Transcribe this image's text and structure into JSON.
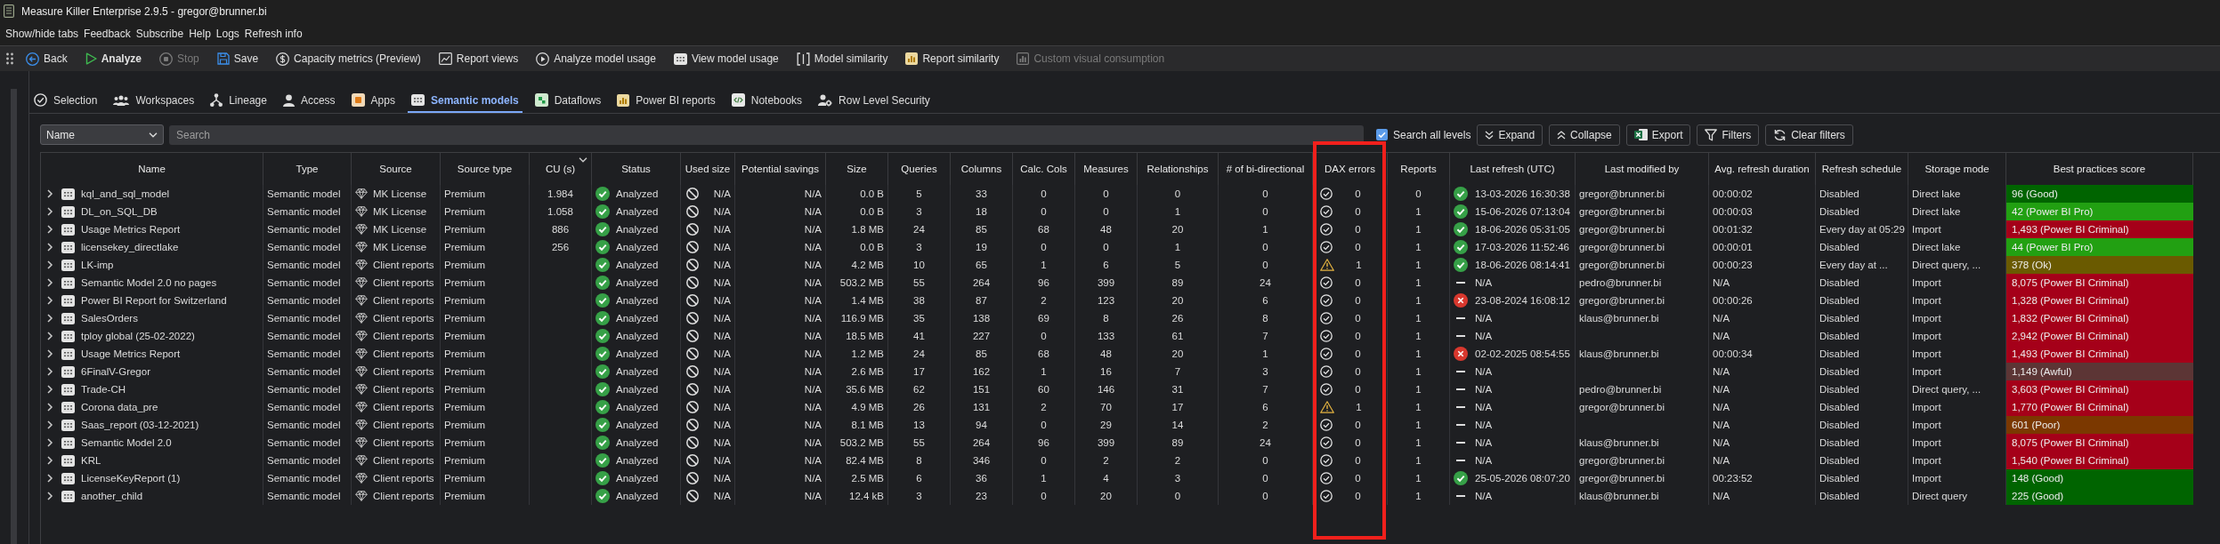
{
  "window": {
    "title": "Measure Killer Enterprise 2.9.5 - gregor@brunner.bi"
  },
  "menu": [
    "Show/hide tabs",
    "Feedback",
    "Subscribe",
    "Help",
    "Logs",
    "Refresh info"
  ],
  "toolbar": [
    {
      "label": "Back",
      "primary": false,
      "disabled": false
    },
    {
      "label": "Analyze",
      "primary": true,
      "disabled": false
    },
    {
      "label": "Stop",
      "primary": false,
      "disabled": true
    },
    {
      "label": "Save",
      "primary": false,
      "disabled": false
    },
    {
      "label": "Capacity metrics (Preview)",
      "primary": false,
      "disabled": false
    },
    {
      "label": "Report views",
      "primary": false,
      "disabled": false
    },
    {
      "label": "Analyze model usage",
      "primary": false,
      "disabled": false
    },
    {
      "label": "View model usage",
      "primary": false,
      "disabled": false
    },
    {
      "label": "Model similarity",
      "primary": false,
      "disabled": false
    },
    {
      "label": "Report similarity",
      "primary": false,
      "disabled": false
    },
    {
      "label": "Custom visual consumption",
      "primary": false,
      "disabled": true
    }
  ],
  "tabs": [
    {
      "label": "Selection",
      "selected": false
    },
    {
      "label": "Workspaces",
      "selected": false
    },
    {
      "label": "Lineage",
      "selected": false
    },
    {
      "label": "Access",
      "selected": false
    },
    {
      "label": "Apps",
      "selected": false
    },
    {
      "label": "Semantic models",
      "selected": true
    },
    {
      "label": "Dataflows",
      "selected": false
    },
    {
      "label": "Power BI reports",
      "selected": false
    },
    {
      "label": "Notebooks",
      "selected": false
    },
    {
      "label": "Row Level Security",
      "selected": false
    }
  ],
  "filter_bar": {
    "field_dropdown": "Name",
    "search": {
      "placeholder": "Search"
    },
    "search_all_levels": {
      "label": "Search all levels",
      "checked": true
    },
    "buttons": [
      "Expand",
      "Collapse",
      "Export",
      "Filters",
      "Clear filters"
    ]
  },
  "table": {
    "columns": [
      {
        "label": "Name",
        "sorted": false,
        "highlighted": false
      },
      {
        "label": "Type",
        "sorted": false,
        "highlighted": false
      },
      {
        "label": "Source",
        "sorted": false,
        "highlighted": false
      },
      {
        "label": "Source type",
        "sorted": false,
        "highlighted": false
      },
      {
        "label": "CU (s)",
        "sorted": true,
        "highlighted": false
      },
      {
        "label": "Status",
        "sorted": false,
        "highlighted": false
      },
      {
        "label": "Used size",
        "sorted": false,
        "highlighted": false
      },
      {
        "label": "Potential savings",
        "sorted": false,
        "highlighted": false
      },
      {
        "label": "Size",
        "sorted": false,
        "highlighted": false
      },
      {
        "label": "Queries",
        "sorted": false,
        "highlighted": false
      },
      {
        "label": "Columns",
        "sorted": false,
        "highlighted": false
      },
      {
        "label": "Calc. Cols",
        "sorted": false,
        "highlighted": false
      },
      {
        "label": "Measures",
        "sorted": false,
        "highlighted": false
      },
      {
        "label": "Relationships",
        "sorted": false,
        "highlighted": false
      },
      {
        "label": "# of bi-directional",
        "sorted": false,
        "highlighted": false
      },
      {
        "label": "DAX errors",
        "sorted": false,
        "highlighted": true
      },
      {
        "label": "Reports",
        "sorted": false,
        "highlighted": false
      },
      {
        "label": "Last refresh (UTC)",
        "sorted": false,
        "highlighted": false
      },
      {
        "label": "Last modified by",
        "sorted": false,
        "highlighted": false
      },
      {
        "label": "Avg. refresh duration",
        "sorted": false,
        "highlighted": false
      },
      {
        "label": "Refresh schedule",
        "sorted": false,
        "highlighted": false
      },
      {
        "label": "Storage mode",
        "sorted": false,
        "highlighted": false
      },
      {
        "label": "Best practices score",
        "sorted": false,
        "highlighted": false
      }
    ],
    "rows": [
      {
        "expanded": false,
        "name": "kql_and_sql_model",
        "type": "Semantic model",
        "source": "MK License",
        "source_type": "Premium",
        "cu": "1.984",
        "status": "Analyzed",
        "used_size": "N/A",
        "potential_savings": "N/A",
        "size": "0.0 B",
        "queries": "5",
        "columns": "33",
        "calc_cols": "0",
        "measures": "0",
        "relationships": "0",
        "bidirectional": "0",
        "dax_warning": false,
        "dax_errors": "0",
        "reports": "0",
        "last_refresh": {
          "kind": "success",
          "time": "13-03-2026 16:30:38"
        },
        "modified_by": "gregor@brunner.bi",
        "avg_refresh": "00:00:02",
        "schedule": "Disabled",
        "storage": "Direct lake",
        "score": "96 (Good)",
        "color": "#006400"
      },
      {
        "expanded": false,
        "name": "DL_on_SQL_DB",
        "type": "Semantic model",
        "source": "MK License",
        "source_type": "Premium",
        "cu": "1.058",
        "status": "Analyzed",
        "used_size": "N/A",
        "potential_savings": "N/A",
        "size": "0.0 B",
        "queries": "3",
        "columns": "18",
        "calc_cols": "0",
        "measures": "0",
        "relationships": "1",
        "bidirectional": "0",
        "dax_warning": false,
        "dax_errors": "0",
        "reports": "1",
        "last_refresh": {
          "kind": "success",
          "time": "15-06-2026 07:13:04"
        },
        "modified_by": "gregor@brunner.bi",
        "avg_refresh": "00:00:03",
        "schedule": "Disabled",
        "storage": "Direct lake",
        "score": "42 (Power BI Pro)",
        "color": "#22a012"
      },
      {
        "expanded": false,
        "name": "Usage Metrics Report",
        "type": "Semantic model",
        "source": "MK License",
        "source_type": "Premium",
        "cu": "886",
        "status": "Analyzed",
        "used_size": "N/A",
        "potential_savings": "N/A",
        "size": "1.8 MB",
        "queries": "24",
        "columns": "85",
        "calc_cols": "68",
        "measures": "48",
        "relationships": "20",
        "bidirectional": "1",
        "dax_warning": false,
        "dax_errors": "0",
        "reports": "1",
        "last_refresh": {
          "kind": "success",
          "time": "18-06-2026 05:31:05"
        },
        "modified_by": "gregor@brunner.bi",
        "avg_refresh": "00:01:32",
        "schedule": "Every day at 05:29",
        "storage": "Import",
        "score": "1,493 (Power BI Criminal)",
        "color": "#a50019"
      },
      {
        "expanded": false,
        "name": "licensekey_directlake",
        "type": "Semantic model",
        "source": "MK License",
        "source_type": "Premium",
        "cu": "256",
        "status": "Analyzed",
        "used_size": "N/A",
        "potential_savings": "N/A",
        "size": "0.0 B",
        "queries": "3",
        "columns": "19",
        "calc_cols": "0",
        "measures": "0",
        "relationships": "1",
        "bidirectional": "0",
        "dax_warning": false,
        "dax_errors": "0",
        "reports": "1",
        "last_refresh": {
          "kind": "success",
          "time": "17-03-2026 11:52:46"
        },
        "modified_by": "gregor@brunner.bi",
        "avg_refresh": "00:00:01",
        "schedule": "Disabled",
        "storage": "Direct lake",
        "score": "44 (Power BI Pro)",
        "color": "#22a012"
      },
      {
        "expanded": false,
        "name": "LK-imp",
        "type": "Semantic model",
        "source": "Client reports",
        "source_type": "Premium",
        "status": "Analyzed",
        "used_size": "N/A",
        "potential_savings": "N/A",
        "size": "4.2 MB",
        "queries": "10",
        "columns": "65",
        "calc_cols": "1",
        "measures": "6",
        "relationships": "5",
        "bidirectional": "0",
        "dax_warning": true,
        "dax_errors": "1",
        "reports": "1",
        "last_refresh": {
          "kind": "success",
          "time": "18-06-2026 08:14:41"
        },
        "modified_by": "gregor@brunner.bi",
        "avg_refresh": "00:00:23",
        "schedule": "Every day at ...",
        "storage": "Direct query, ...",
        "score": "378 (Ok)",
        "color": "#6a5a00"
      },
      {
        "expanded": false,
        "name": "Semantic Model 2.0 no pages",
        "type": "Semantic model",
        "source": "Client reports",
        "source_type": "Premium",
        "status": "Analyzed",
        "used_size": "N/A",
        "potential_savings": "N/A",
        "size": "503.2 MB",
        "queries": "55",
        "columns": "264",
        "calc_cols": "96",
        "measures": "399",
        "relationships": "89",
        "bidirectional": "24",
        "dax_warning": false,
        "dax_errors": "0",
        "reports": "1",
        "last_refresh": {
          "kind": "none",
          "time": "N/A"
        },
        "modified_by": "pedro@brunner.bi",
        "avg_refresh": "N/A",
        "schedule": "Disabled",
        "storage": "Import",
        "score": "8,075 (Power BI Criminal)",
        "color": "#a50019"
      },
      {
        "expanded": false,
        "name": "Power BI Report for Switzerland",
        "type": "Semantic model",
        "source": "Client reports",
        "source_type": "Premium",
        "status": "Analyzed",
        "used_size": "N/A",
        "potential_savings": "N/A",
        "size": "1.4 MB",
        "queries": "38",
        "columns": "87",
        "calc_cols": "2",
        "measures": "123",
        "relationships": "20",
        "bidirectional": "6",
        "dax_warning": false,
        "dax_errors": "0",
        "reports": "1",
        "last_refresh": {
          "kind": "failed",
          "time": "23-08-2024 16:08:12"
        },
        "modified_by": "gregor@brunner.bi",
        "avg_refresh": "00:00:26",
        "schedule": "Disabled",
        "storage": "Import",
        "score": "1,328 (Power BI Criminal)",
        "color": "#a50019"
      },
      {
        "expanded": false,
        "name": "SalesOrders",
        "type": "Semantic model",
        "source": "Client reports",
        "source_type": "Premium",
        "status": "Analyzed",
        "used_size": "N/A",
        "potential_savings": "N/A",
        "size": "116.9 MB",
        "queries": "35",
        "columns": "138",
        "calc_cols": "69",
        "measures": "8",
        "relationships": "26",
        "bidirectional": "8",
        "dax_warning": false,
        "dax_errors": "0",
        "reports": "1",
        "last_refresh": {
          "kind": "none",
          "time": "N/A"
        },
        "modified_by": "klaus@brunner.bi",
        "avg_refresh": "N/A",
        "schedule": "Disabled",
        "storage": "Import",
        "score": "1,832 (Power BI Criminal)",
        "color": "#a50019"
      },
      {
        "expanded": false,
        "name": "tploy global (25-02-2022)",
        "type": "Semantic model",
        "source": "Client reports",
        "source_type": "Premium",
        "status": "Analyzed",
        "used_size": "N/A",
        "potential_savings": "N/A",
        "size": "18.5 MB",
        "queries": "41",
        "columns": "227",
        "calc_cols": "0",
        "measures": "133",
        "relationships": "61",
        "bidirectional": "7",
        "dax_warning": false,
        "dax_errors": "0",
        "reports": "1",
        "last_refresh": {
          "kind": "none",
          "time": "N/A"
        },
        "avg_refresh": "N/A",
        "schedule": "Disabled",
        "storage": "Import",
        "score": "2,942 (Power BI Criminal)",
        "color": "#a50019"
      },
      {
        "expanded": false,
        "name": "Usage Metrics Report",
        "type": "Semantic model",
        "source": "Client reports",
        "source_type": "Premium",
        "status": "Analyzed",
        "used_size": "N/A",
        "potential_savings": "N/A",
        "size": "1.2 MB",
        "queries": "24",
        "columns": "85",
        "calc_cols": "68",
        "measures": "48",
        "relationships": "20",
        "bidirectional": "1",
        "dax_warning": false,
        "dax_errors": "0",
        "reports": "1",
        "last_refresh": {
          "kind": "failed",
          "time": "02-02-2025 08:54:55"
        },
        "modified_by": "klaus@brunner.bi",
        "avg_refresh": "00:00:34",
        "schedule": "Disabled",
        "storage": "Import",
        "score": "1,493 (Power BI Criminal)",
        "color": "#a50019"
      },
      {
        "expanded": false,
        "name": "6FinalV-Gregor",
        "type": "Semantic model",
        "source": "Client reports",
        "source_type": "Premium",
        "status": "Analyzed",
        "used_size": "N/A",
        "potential_savings": "N/A",
        "size": "2.6 MB",
        "queries": "17",
        "columns": "162",
        "calc_cols": "1",
        "measures": "16",
        "relationships": "7",
        "bidirectional": "3",
        "dax_warning": false,
        "dax_errors": "0",
        "reports": "1",
        "last_refresh": {
          "kind": "none",
          "time": "N/A"
        },
        "avg_refresh": "N/A",
        "schedule": "Disabled",
        "storage": "Import",
        "score": "1,149 (Awful)",
        "color": "#5c3535"
      },
      {
        "expanded": false,
        "name": "Trade-CH",
        "type": "Semantic model",
        "source": "Client reports",
        "source_type": "Premium",
        "status": "Analyzed",
        "used_size": "N/A",
        "potential_savings": "N/A",
        "size": "35.6 MB",
        "queries": "62",
        "columns": "151",
        "calc_cols": "60",
        "measures": "146",
        "relationships": "31",
        "bidirectional": "7",
        "dax_warning": false,
        "dax_errors": "0",
        "reports": "1",
        "last_refresh": {
          "kind": "none",
          "time": "N/A"
        },
        "modified_by": "pedro@brunner.bi",
        "avg_refresh": "N/A",
        "schedule": "Disabled",
        "storage": "Direct query, ...",
        "score": "3,603 (Power BI Criminal)",
        "color": "#a50019"
      },
      {
        "expanded": false,
        "name": "Corona data_pre",
        "type": "Semantic model",
        "source": "Client reports",
        "source_type": "Premium",
        "status": "Analyzed",
        "used_size": "N/A",
        "potential_savings": "N/A",
        "size": "4.9 MB",
        "queries": "26",
        "columns": "131",
        "calc_cols": "2",
        "measures": "70",
        "relationships": "17",
        "bidirectional": "6",
        "dax_warning": true,
        "dax_errors": "1",
        "reports": "1",
        "last_refresh": {
          "kind": "none",
          "time": "N/A"
        },
        "modified_by": "gregor@brunner.bi",
        "avg_refresh": "N/A",
        "schedule": "Disabled",
        "storage": "Import",
        "score": "1,770 (Power BI Criminal)",
        "color": "#a50019"
      },
      {
        "expanded": false,
        "name": "Saas_report (03-12-2021)",
        "type": "Semantic model",
        "source": "Client reports",
        "source_type": "Premium",
        "status": "Analyzed",
        "used_size": "N/A",
        "potential_savings": "N/A",
        "size": "8.1 MB",
        "queries": "13",
        "columns": "94",
        "calc_cols": "0",
        "measures": "29",
        "relationships": "14",
        "bidirectional": "2",
        "dax_warning": false,
        "dax_errors": "0",
        "reports": "1",
        "last_refresh": {
          "kind": "none",
          "time": "N/A"
        },
        "avg_refresh": "N/A",
        "schedule": "Disabled",
        "storage": "Import",
        "score": "601 (Poor)",
        "color": "#7b3800"
      },
      {
        "expanded": false,
        "name": "Semantic Model 2.0",
        "type": "Semantic model",
        "source": "Client reports",
        "source_type": "Premium",
        "status": "Analyzed",
        "used_size": "N/A",
        "potential_savings": "N/A",
        "size": "503.2 MB",
        "queries": "55",
        "columns": "264",
        "calc_cols": "96",
        "measures": "399",
        "relationships": "89",
        "bidirectional": "24",
        "dax_warning": false,
        "dax_errors": "0",
        "reports": "1",
        "last_refresh": {
          "kind": "none",
          "time": "N/A"
        },
        "modified_by": "klaus@brunner.bi",
        "avg_refresh": "N/A",
        "schedule": "Disabled",
        "storage": "Import",
        "score": "8,075 (Power BI Criminal)",
        "color": "#a50019"
      },
      {
        "expanded": false,
        "name": "KRL",
        "type": "Semantic model",
        "source": "Client reports",
        "source_type": "Premium",
        "status": "Analyzed",
        "used_size": "N/A",
        "potential_savings": "N/A",
        "size": "82.4 MB",
        "queries": "8",
        "columns": "346",
        "calc_cols": "0",
        "measures": "2",
        "relationships": "2",
        "bidirectional": "0",
        "dax_warning": false,
        "dax_errors": "0",
        "reports": "1",
        "last_refresh": {
          "kind": "none",
          "time": "N/A"
        },
        "modified_by": "gregor@brunner.bi",
        "avg_refresh": "N/A",
        "schedule": "Disabled",
        "storage": "Import",
        "score": "1,540 (Power BI Criminal)",
        "color": "#a50019"
      },
      {
        "expanded": false,
        "name": "LicenseKeyReport (1)",
        "type": "Semantic model",
        "source": "Client reports",
        "source_type": "Premium",
        "status": "Analyzed",
        "used_size": "N/A",
        "potential_savings": "N/A",
        "size": "2.5 MB",
        "queries": "6",
        "columns": "36",
        "calc_cols": "1",
        "measures": "4",
        "relationships": "3",
        "bidirectional": "0",
        "dax_warning": false,
        "dax_errors": "0",
        "reports": "1",
        "last_refresh": {
          "kind": "success",
          "time": "25-05-2026 08:07:20"
        },
        "modified_by": "gregor@brunner.bi",
        "avg_refresh": "00:23:52",
        "schedule": "Disabled",
        "storage": "Import",
        "score": "148 (Good)",
        "color": "#006400"
      },
      {
        "expanded": false,
        "name": "another_child",
        "type": "Semantic model",
        "source": "Client reports",
        "source_type": "Premium",
        "status": "Analyzed",
        "used_size": "N/A",
        "potential_savings": "N/A",
        "size": "12.4 kB",
        "queries": "3",
        "columns": "23",
        "calc_cols": "0",
        "measures": "20",
        "relationships": "0",
        "bidirectional": "0",
        "dax_warning": false,
        "dax_errors": "0",
        "reports": "1",
        "last_refresh": {
          "kind": "none",
          "time": "N/A"
        },
        "modified_by": "klaus@brunner.bi",
        "avg_refresh": "N/A",
        "schedule": "Disabled",
        "storage": "Direct query",
        "score": "225 (Good)",
        "color": "#006400"
      }
    ]
  }
}
